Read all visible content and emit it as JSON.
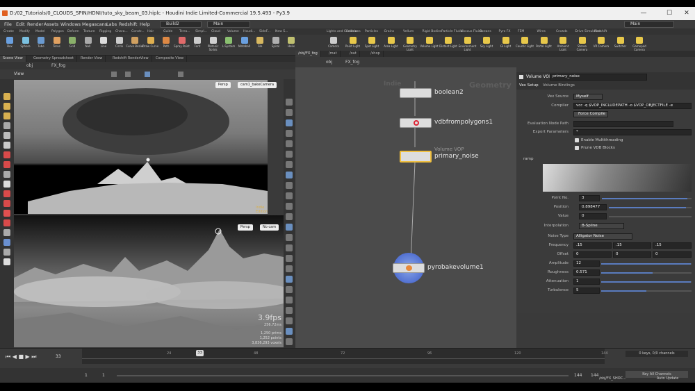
{
  "window": {
    "title": "D:/02_Tutorials/0_CLOUDS_SPIN/HDNI/tuto_sky_beam_03.hiplc - Houdini Indie Limited-Commercial 19.5.493 - Py3.9",
    "minimize": "—",
    "maximize": "☐",
    "close": "✕"
  },
  "menu": {
    "items": [
      "File",
      "Edit",
      "Render",
      "Assets",
      "Windows",
      "Megascans",
      "Labs",
      "Redshift",
      "Help"
    ],
    "desktop": "Build2",
    "main_left": "Main",
    "main_right": "Main"
  },
  "shelf_tabs_left": [
    "Create",
    "Modify",
    "Model",
    "Polygon",
    "Deform",
    "Texture",
    "Rigging",
    "Chara...",
    "Constr...",
    "Hair",
    "Guide",
    "Terra...",
    "Simpl...",
    "Cloud",
    "Volume",
    "Houdi...",
    "SideF...",
    "New S..."
  ],
  "shelf_tabs_right": [
    "Lights and Cameras",
    "Collisions",
    "Particles",
    "Grains",
    "Vellum",
    "Rigid Bodies",
    "Particle Fluids",
    "Viscous Fluids",
    "Oceans",
    "Pyro FX",
    "FEM",
    "Wires",
    "Crowds",
    "Drive Simulation",
    "Redshift"
  ],
  "tools_left": [
    "Box",
    "Sphere",
    "Tube",
    "Torus",
    "Grid",
    "Null",
    "Line",
    "Circle",
    "Curve Bezier",
    "Draw Curve",
    "Path",
    "Spray Paint",
    "Font",
    "Platonic Solids",
    "L-System",
    "Metaball",
    "File",
    "Spiral",
    "Helix"
  ],
  "tools_right": [
    "Camera",
    "Point Light",
    "Spot Light",
    "Area Light",
    "Geometry Light",
    "Volume Light",
    "Distant Light",
    "Environment Light",
    "Sky Light",
    "GI Light",
    "Caustic Light",
    "Portal Light",
    "Ambient Light",
    "Stereo Camera",
    "VR Camera",
    "Switcher",
    "Gamepad Camera"
  ],
  "left_pane_tabs": [
    "Scene View",
    "Geometry Spreadsheet",
    "Render View",
    "Redshift RenderView",
    "Composite View"
  ],
  "right_pane_tabs": [
    "/obj/FX_fog",
    "/mat",
    "/out",
    "/shop"
  ],
  "viewport": {
    "path_obj": "obj",
    "path_node": "FX_fog",
    "view_label": "View",
    "top": {
      "projection": "Persp",
      "camera": "cam1_bakeCamera",
      "watermark": "Indie Edition"
    },
    "bottom": {
      "projection": "Persp",
      "camera": "No cam"
    },
    "stats": {
      "fps": "3.9fps",
      "ms": "256.72ms",
      "prims": "1,250  prims",
      "points": "1,252 points",
      "voxels": "3,836,293 voxels"
    }
  },
  "network": {
    "path_obj": "obj",
    "path_node": "FX_fog",
    "context": "Geometry",
    "watermark": "Indie",
    "nodes": [
      {
        "name": "boolean2",
        "type": ""
      },
      {
        "name": "vdbfrompolygons1",
        "type": ""
      },
      {
        "name": "primary_noise",
        "type": "Volume VOP"
      },
      {
        "name": "pyrobakevolume1",
        "type": ""
      }
    ]
  },
  "params": {
    "node_type": "Volume VOP",
    "node_name": "primary_noise",
    "tabs": [
      "Vex Setup",
      "Volume Bindings"
    ],
    "vex_source_label": "Vex Source",
    "vex_source": "Myself",
    "compiler_label": "Compiler",
    "compiler": "vcc -q $VOP_INCLUDEPATH -o $VOP_OBJECTFILE -e",
    "force_compile": "Force Compile",
    "eval_node_label": "Evaluation Node Path",
    "eval_node": "",
    "export_label": "Export Parameters",
    "export_val": "*",
    "multithread": "Enable Multithreading",
    "prune": "Prune VDB Blocks",
    "ramp_label": "ramp",
    "point_no_label": "Point No.",
    "point_no": "3",
    "position_label": "Position",
    "position": "0.898477",
    "value_label": "Value",
    "value": "0",
    "interp_label": "Interpolation",
    "interp": "B-Spline",
    "noise_type_label": "Noise Type",
    "noise_type": "Alligator Noise",
    "freq_label": "Frequency",
    "freq": [
      ".15",
      ".15",
      ".15"
    ],
    "offset_label": "Offset",
    "offset": [
      "0",
      "0",
      "0"
    ],
    "amp_label": "Amplitude",
    "amp": "12",
    "rough_label": "Roughness",
    "rough": "0.571",
    "atten_label": "Attenuation",
    "atten": "1",
    "turb_label": "Turbulence",
    "turb": "5"
  },
  "timeline": {
    "frame": "33",
    "ticks": [
      "24",
      "48",
      "72",
      "96",
      "120",
      "144"
    ],
    "start": "1",
    "start2": "1",
    "end": "144",
    "end2": "144",
    "keys": "0 keys, 0/0 channels",
    "all_channels": "Key All Channels",
    "path": "/obj/FX_SHOC...",
    "auto_update": "Auto Update"
  }
}
